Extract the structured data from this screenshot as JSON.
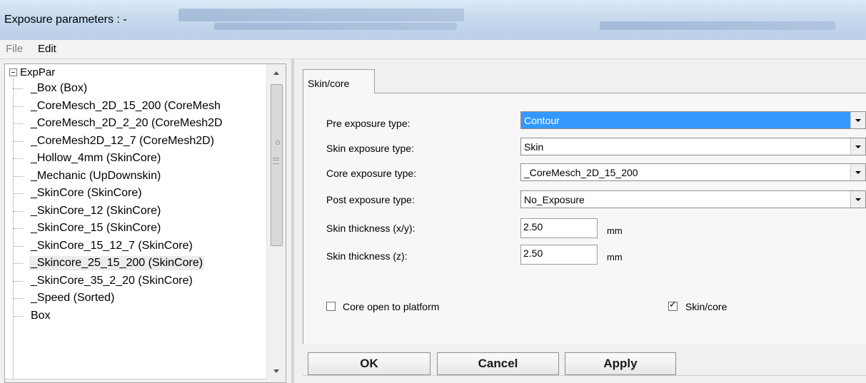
{
  "window": {
    "title": "Exposure parameters :  -"
  },
  "menu": {
    "file": "File",
    "edit": "Edit"
  },
  "tree": {
    "root": "ExpPar",
    "items": [
      {
        "label": "_Box (Box)"
      },
      {
        "label": "_CoreMesch_2D_15_200 (CoreMesh"
      },
      {
        "label": "_CoreMesch_2D_2_20 (CoreMesh2D"
      },
      {
        "label": "_CoreMesh2D_12_7 (CoreMesh2D)"
      },
      {
        "label": "_Hollow_4mm (SkinCore)"
      },
      {
        "label": "_Mechanic (UpDownskin)"
      },
      {
        "label": "_SkinCore (SkinCore)"
      },
      {
        "label": "_SkinCore_12 (SkinCore)"
      },
      {
        "label": "_SkinCore_15 (SkinCore)"
      },
      {
        "label": "_SkinCore_15_12_7 (SkinCore)"
      },
      {
        "label": "_Skincore_25_15_200 (SkinCore)",
        "selected": true
      },
      {
        "label": "_SkinCore_35_2_20 (SkinCore)"
      },
      {
        "label": "_Speed (Sorted)"
      },
      {
        "label": "Box"
      }
    ]
  },
  "tabs": {
    "active": "Skin/core"
  },
  "form": {
    "pre_exposure": {
      "label": "Pre exposure type:",
      "value": "Contour"
    },
    "skin_exposure": {
      "label": "Skin exposure type:",
      "value": "Skin"
    },
    "core_exposure": {
      "label": "Core exposure type:",
      "value": "_CoreMesch_2D_15_200"
    },
    "post_exposure": {
      "label": "Post exposure type:",
      "value": "No_Exposure"
    },
    "skin_thickness_xy": {
      "label": "Skin thickness (x/y):",
      "value": "2.50",
      "unit": "mm"
    },
    "skin_thickness_z": {
      "label": "Skin thickness (z):",
      "value": "2.50",
      "unit": "mm"
    },
    "core_open": {
      "label": "Core open to platform",
      "checked": false
    },
    "skin_core": {
      "label": "Skin/core",
      "checked": true
    }
  },
  "buttons": {
    "ok": "OK",
    "cancel": "Cancel",
    "apply": "Apply"
  },
  "colors": {
    "selection": "#3399ff",
    "title_bar": "#c6d9ee"
  }
}
